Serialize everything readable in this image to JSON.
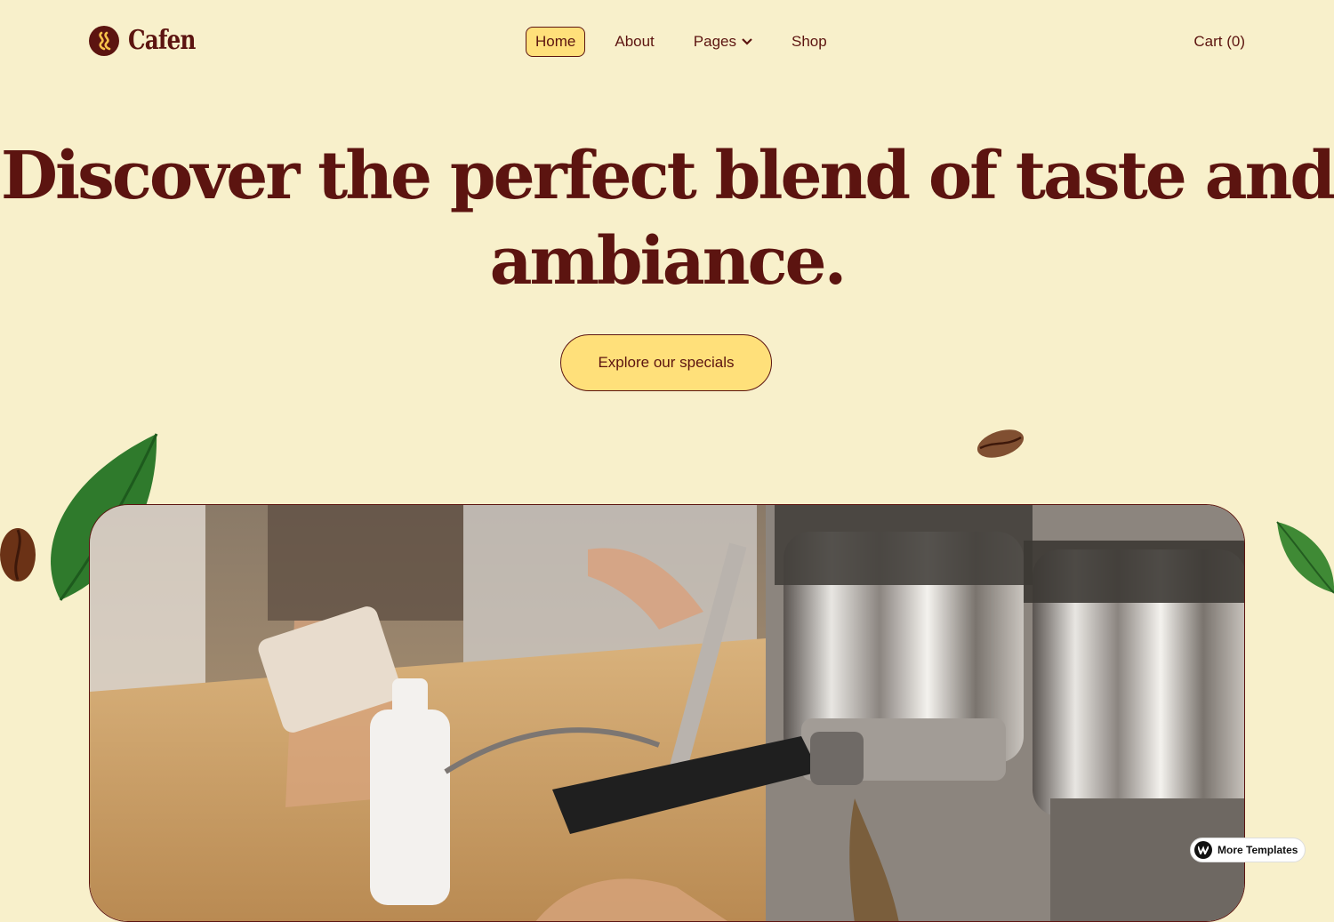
{
  "brand": {
    "name": "Cafen",
    "logo_icon": "coffee-steam-logo-icon"
  },
  "nav": {
    "items": [
      {
        "label": "Home",
        "active": true
      },
      {
        "label": "About",
        "active": false
      },
      {
        "label": "Pages",
        "active": false,
        "has_dropdown": true
      },
      {
        "label": "Shop",
        "active": false
      }
    ]
  },
  "cart": {
    "label": "Cart (0)"
  },
  "hero": {
    "heading": "Discover the perfect blend of taste and ambiance.",
    "cta_label": "Explore our specials",
    "image_subject": "espresso-machine-photo"
  },
  "badge": {
    "label": "More Templates",
    "icon": "webflow-icon"
  },
  "colors": {
    "background": "#f8f0cb",
    "primary": "#5c1410",
    "accent": "#ffe07a"
  }
}
